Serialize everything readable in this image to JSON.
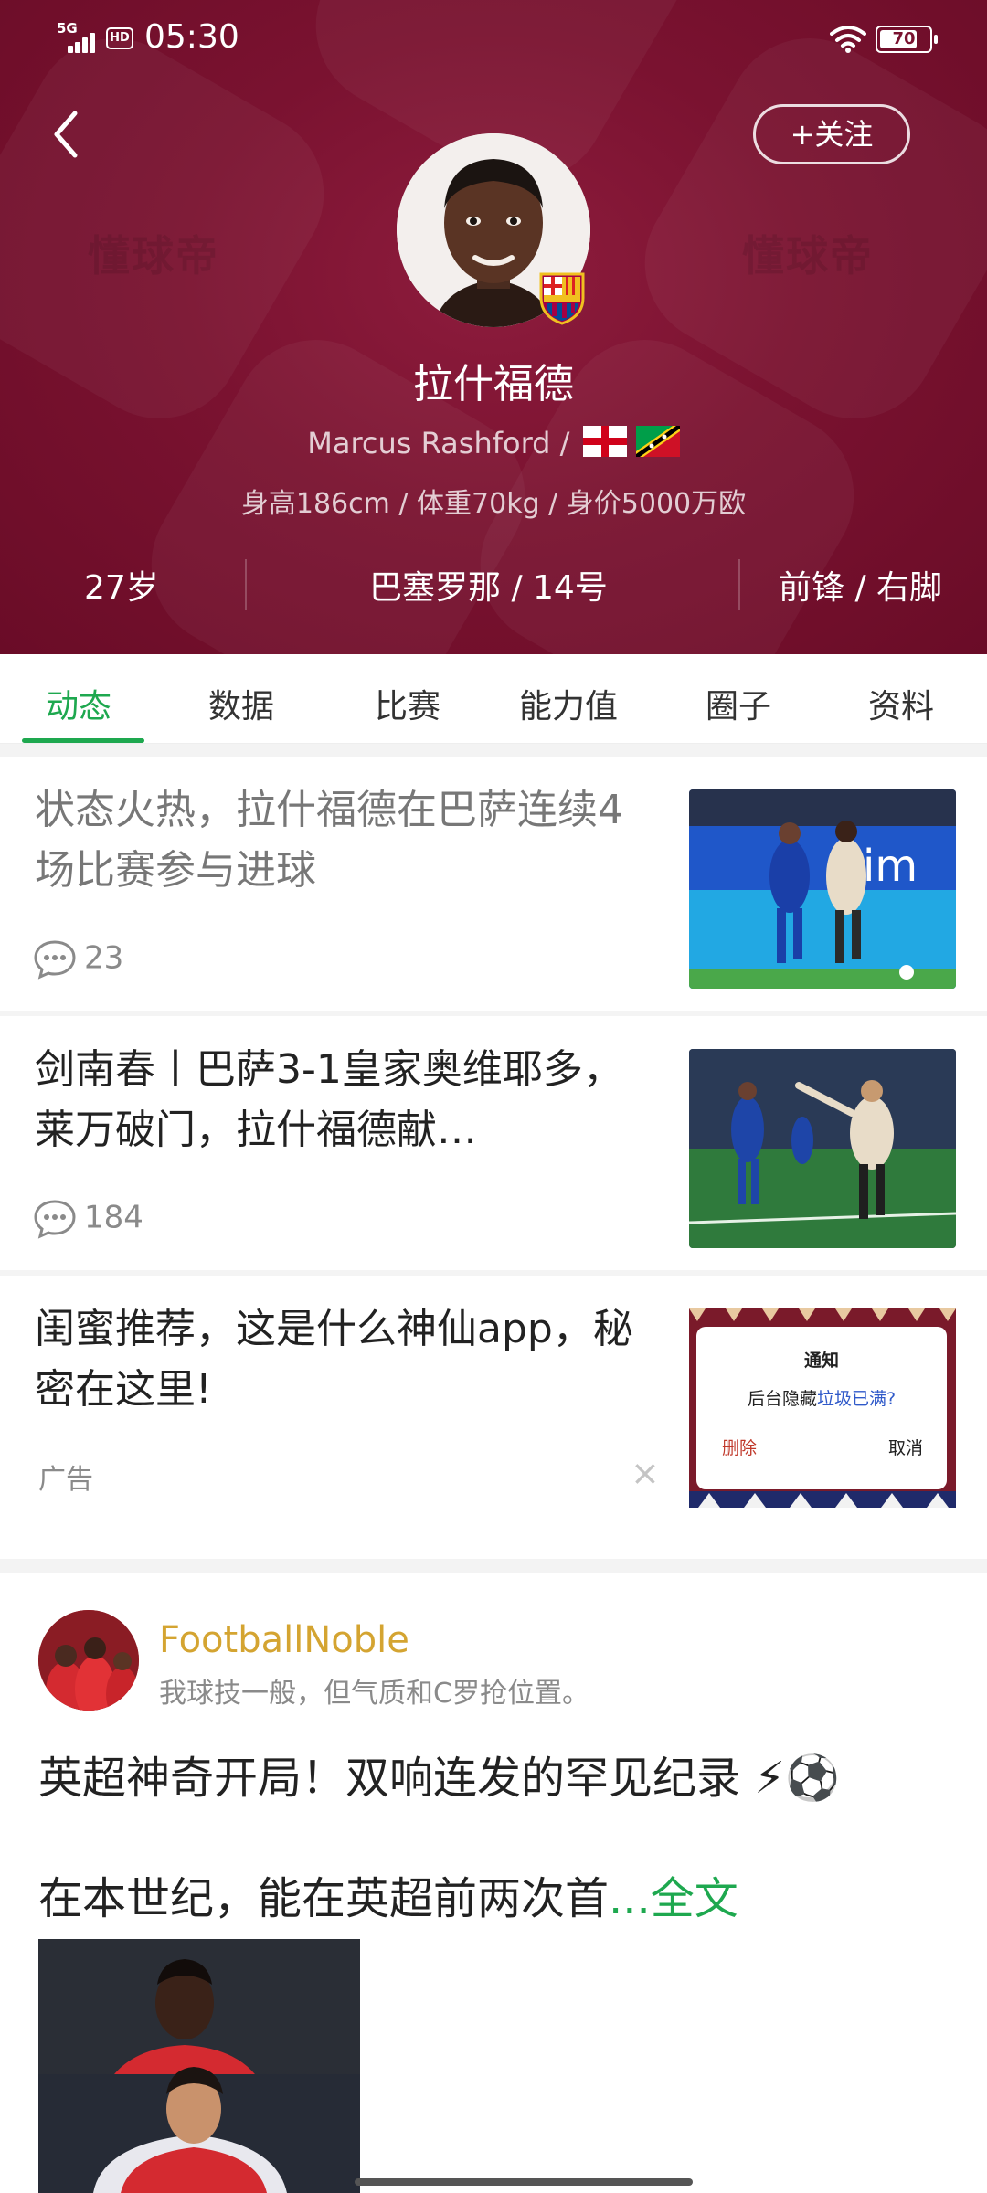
{
  "status_bar": {
    "network": "5G",
    "hd": "HD",
    "time": "05:30",
    "battery": "70"
  },
  "header": {
    "follow_label": "+关注",
    "player_name_cn": "拉什福德",
    "player_name_en": "Marcus Rashford /",
    "stats_line": "身高186cm / 体重70kg / 身价5000万欧",
    "age": "27岁",
    "club_number": "巴塞罗那 / 14号",
    "position_foot": "前锋 / 右脚",
    "watermark": "懂球帝"
  },
  "tabs": [
    "动态",
    "数据",
    "比赛",
    "能力值",
    "圈子",
    "资料"
  ],
  "active_tab": 0,
  "articles": [
    {
      "title": "状态火热，拉什福德在巴萨连续4场比赛参与进球",
      "comments": "23"
    },
    {
      "title": "剑南春丨巴萨3-1皇家奥维耶多，莱万破门，拉什福德献…",
      "comments": "184"
    }
  ],
  "ad": {
    "title": "闺蜜推荐，这是什么神仙app，秘密在这里!",
    "label": "广告",
    "close": "×",
    "dialog_title": "通知",
    "dialog_text_prefix": "后台隐藏",
    "dialog_text_highlight": "垃圾已满?",
    "dialog_delete": "删除",
    "dialog_cancel": "取消"
  },
  "post": {
    "author": "FootballNoble",
    "signature": "我球技一般，但气质和C罗抢位置。",
    "line1": "英超神奇开局！双响连发的罕见纪录 ⚡⚽",
    "line2": "在本世纪，能在英超前两次首",
    "more": "...全文"
  },
  "colors": {
    "header_bg": "#7a1230",
    "accent_green": "#1ea84f",
    "author_gold": "#d4a431"
  }
}
